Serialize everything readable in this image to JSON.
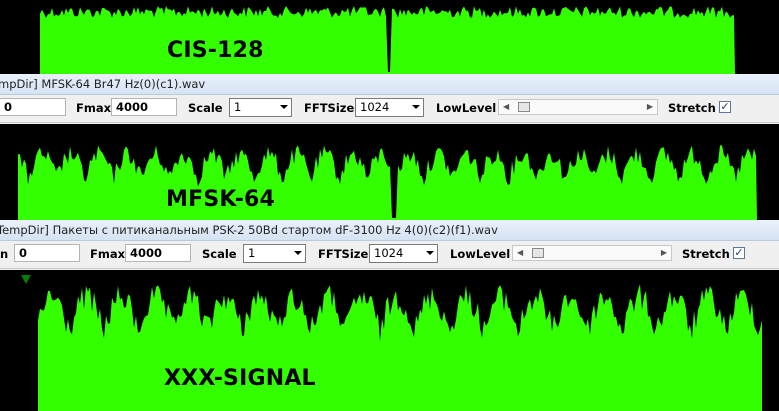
{
  "colors": {
    "signal": "#33ff00",
    "background": "#000000",
    "label": "#000000"
  },
  "panels": [
    {
      "label": "CIS-128"
    },
    {
      "label": "MFSK-64"
    },
    {
      "label": "XXX-SIGNAL"
    }
  ],
  "windows": [
    {
      "title": "mpDir] MFSK-64 Br47 Hz(0)(c1).wav",
      "fmin_value": "0",
      "fmax_label": "Fmax",
      "fmax_value": "4000",
      "scale_label": "Scale",
      "scale_value": "1",
      "fftsize_label": "FFTSize",
      "fftsize_value": "1024",
      "lowlevel_label": "LowLevel",
      "lowlevel_level": 0.03,
      "stretch_label": "Stretch",
      "stretch_checked": true
    },
    {
      "title": "TempDir] Пакеты с питиканальным PSK-2 50Bd стартом dF-3100 Hz 4(0)(c2)(f1).wav",
      "fmin_label_fragment": "n",
      "fmin_value": "0",
      "fmax_label": "Fmax",
      "fmax_value": "4000",
      "scale_label": "Scale",
      "scale_value": "1",
      "fftsize_label": "FFTSize",
      "fftsize_value": "1024",
      "lowlevel_label": "LowLevel",
      "lowlevel_level": 0.03,
      "stretch_label": "Stretch",
      "stretch_checked": true
    }
  ]
}
